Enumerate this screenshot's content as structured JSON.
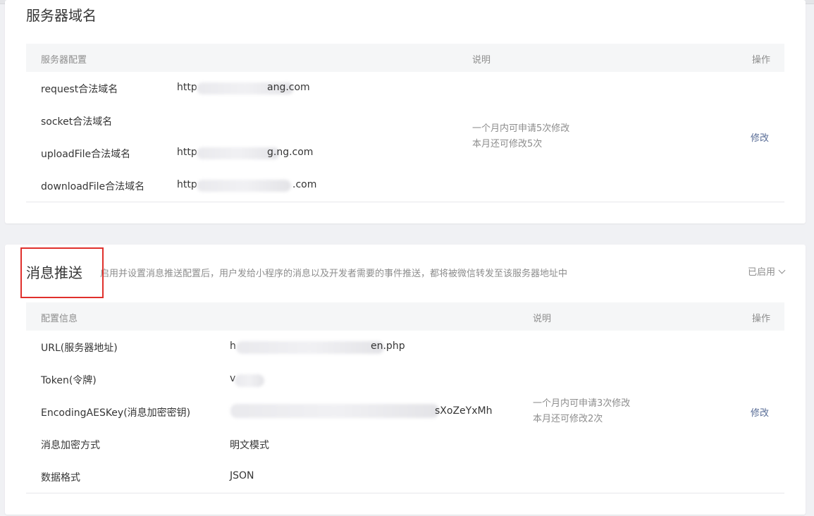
{
  "server_domain": {
    "title": "服务器域名",
    "table_headers": {
      "config": "服务器配置",
      "note": "说明",
      "action": "操作"
    },
    "rows": [
      {
        "label": "request合法域名",
        "value_prefix": "http",
        "value_suffix": "ang.com"
      },
      {
        "label": "socket合法域名",
        "value_prefix": "",
        "value_suffix": ""
      },
      {
        "label": "uploadFile合法域名",
        "value_prefix": "http",
        "value_suffix": "g.ng.com"
      },
      {
        "label": "downloadFile合法域名",
        "value_prefix": "http",
        "value_suffix": ".com"
      }
    ],
    "note_line1": "一个月内可申请5次修改",
    "note_line2": "本月还可修改5次",
    "modify_label": "修改"
  },
  "message_push": {
    "title": "消息推送",
    "description": "启用并设置消息推送配置后，用户发给小程序的消息以及开发者需要的事件推送，都将被微信转发至该服务器地址中",
    "status_label": "已启用",
    "table_headers": {
      "config": "配置信息",
      "note": "说明",
      "action": "操作"
    },
    "rows": [
      {
        "label": "URL(服务器地址)",
        "value_prefix": "h",
        "value_suffix": "en.php"
      },
      {
        "label": "Token(令牌)",
        "value_prefix": "v",
        "value_suffix": ""
      },
      {
        "label": "EncodingAESKey(消息加密密钥)",
        "value_prefix": "",
        "value_suffix": "sXoZeYxMh"
      },
      {
        "label": "消息加密方式",
        "value_prefix": "明文模式",
        "value_suffix": ""
      },
      {
        "label": "数据格式",
        "value_prefix": "JSON",
        "value_suffix": ""
      }
    ],
    "note_line1": "一个月内可申请3次修改",
    "note_line2": "本月还可修改2次",
    "modify_label": "修改"
  },
  "colors": {
    "link": "#576b95",
    "highlight_border": "#e0302c",
    "header_bg": "#f5f6f7",
    "page_bg": "#f0f1f4"
  }
}
